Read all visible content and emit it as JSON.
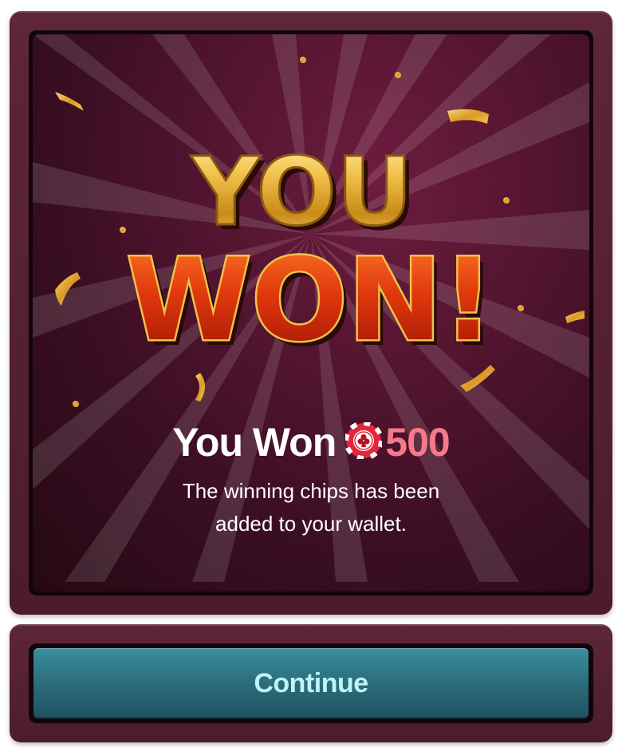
{
  "dialog": {
    "headline_line1": "YOU",
    "headline_line2": "WON!",
    "won_label": "You Won",
    "chip_icon": "poker-chip-icon",
    "won_amount": "500",
    "description_line1": "The winning chips has been",
    "description_line2": "added to your wallet.",
    "continue_label": "Continue"
  },
  "colors": {
    "frame": "#55202f",
    "panel": "#4a1229",
    "gold": "#e9b23a",
    "red_title": "#d63a0c",
    "amount": "#f47a8b",
    "button": "#2f7b8a",
    "button_text": "#bff4f6"
  }
}
